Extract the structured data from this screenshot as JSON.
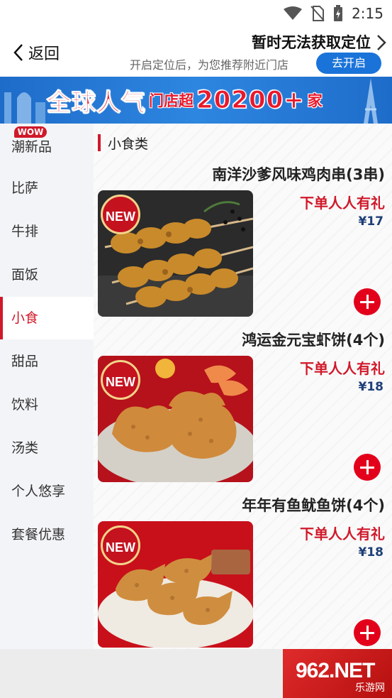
{
  "status_bar": {
    "time": "2:15"
  },
  "header": {
    "back_label": "返回",
    "location_title": "暂时无法获取定位",
    "location_subtitle": "开启定位后，为您推荐附近门店",
    "open_button": "去开启"
  },
  "banner": {
    "part1": "全球人气",
    "part2": "门店超",
    "part3": "20200+",
    "part4": "家"
  },
  "sidebar": {
    "wow_badge": "WOW",
    "items": [
      {
        "label": "潮新品"
      },
      {
        "label": "比萨"
      },
      {
        "label": "牛排"
      },
      {
        "label": "面饭"
      },
      {
        "label": "小食",
        "active": true
      },
      {
        "label": "甜品"
      },
      {
        "label": "饮料"
      },
      {
        "label": "汤类"
      },
      {
        "label": "个人悠享"
      },
      {
        "label": "套餐优惠"
      }
    ]
  },
  "content": {
    "section_title": "小食类",
    "products": [
      {
        "name": "南洋沙爹风味鸡肉串(3串)",
        "promo": "下单人人有礼",
        "price": "¥17",
        "badge": "NEW",
        "icon": "chicken-skewer"
      },
      {
        "name": "鸿运金元宝虾饼(4个)",
        "promo": "下单人人有礼",
        "price": "¥18",
        "badge": "NEW",
        "icon": "shrimp-cake"
      },
      {
        "name": "年年有鱼鱿鱼饼(4个)",
        "promo": "下单人人有礼",
        "price": "¥18",
        "badge": "NEW",
        "icon": "squid-cake"
      }
    ]
  },
  "watermark": {
    "logo": "962.NET",
    "sub": "乐游网"
  },
  "colors": {
    "accent_red": "#d0192a",
    "button_blue": "#1a73d9",
    "price_blue": "#1e3f78"
  }
}
